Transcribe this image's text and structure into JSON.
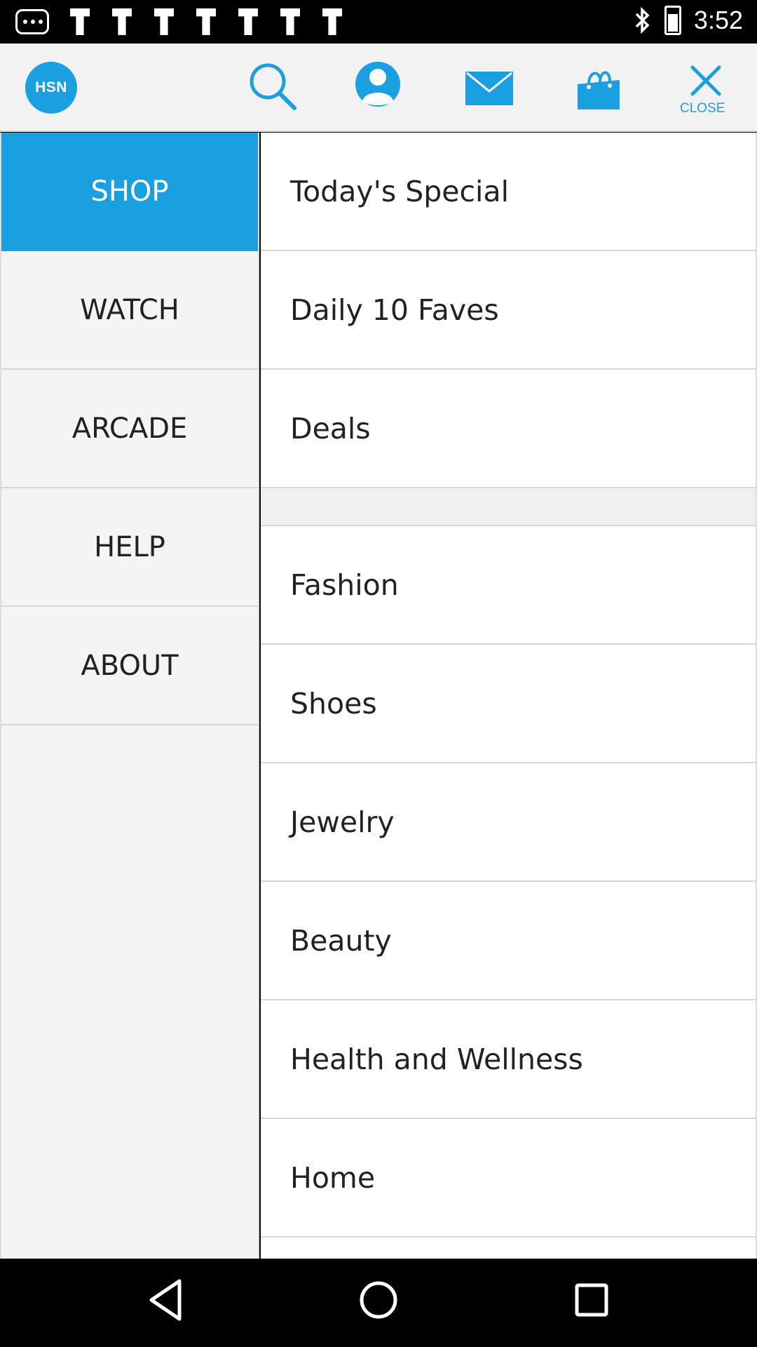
{
  "status_bar": {
    "time": "3:52",
    "icons": [
      "messages-icon",
      "flag-icon",
      "flag-icon",
      "flag-icon",
      "flag-icon",
      "flag-icon",
      "flag-icon",
      "flag-icon",
      "bluetooth-icon",
      "battery-icon"
    ]
  },
  "header": {
    "logo_text": "HSN",
    "close_label": "CLOSE",
    "icons": [
      "search-icon",
      "profile-icon",
      "mail-icon",
      "shopping-bag-icon",
      "close-icon"
    ],
    "accent_color": "#1a9fe0"
  },
  "left_menu": {
    "items": [
      {
        "label": "SHOP",
        "active": true
      },
      {
        "label": "WATCH",
        "active": false
      },
      {
        "label": "ARCADE",
        "active": false
      },
      {
        "label": "HELP",
        "active": false
      },
      {
        "label": "ABOUT",
        "active": false
      }
    ]
  },
  "shop_menu": {
    "top_items": [
      {
        "label": "Today's Special"
      },
      {
        "label": "Daily 10 Faves"
      },
      {
        "label": "Deals"
      }
    ],
    "category_items": [
      {
        "label": "Fashion"
      },
      {
        "label": "Shoes"
      },
      {
        "label": "Jewelry"
      },
      {
        "label": "Beauty"
      },
      {
        "label": "Health and Wellness"
      },
      {
        "label": "Home"
      }
    ]
  },
  "nav_bar": {
    "icons": [
      "back-icon",
      "home-icon",
      "recents-icon"
    ]
  }
}
